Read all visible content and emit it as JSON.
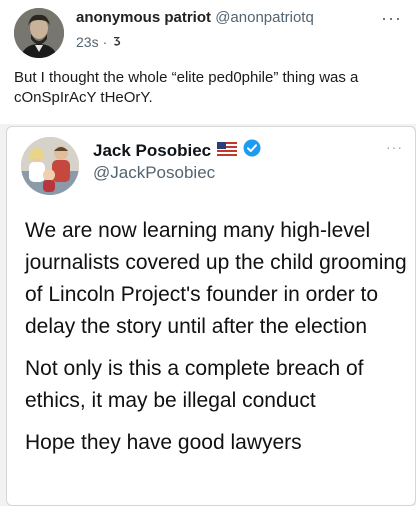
{
  "outer_tweet": {
    "display_name": "anonymous patriot",
    "handle": "@anonpatriotq",
    "time": "23s",
    "separator": "·",
    "text": "But I thought the whole “elite ped0phile” thing was a cOnSpIrAcY tHeOrY.",
    "more_label": "···"
  },
  "quoted_tweet": {
    "display_name": "Jack Posobiec",
    "handle": "@JackPosobiec",
    "more_label": "···",
    "paragraphs": [
      "We are now learning many high-level journalists covered up the child grooming of Lincoln Project's founder in order to delay the story until after the election",
      "Not only is this a complete breach of ethics, it may be illegal conduct",
      "Hope they have good lawyers"
    ]
  },
  "colors": {
    "verified": "#1d9bf0",
    "secondary_text": "#536471"
  }
}
